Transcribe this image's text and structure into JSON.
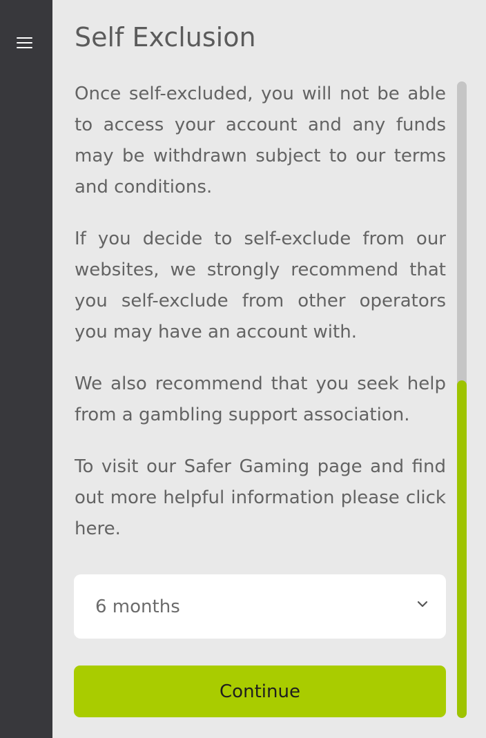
{
  "header": {
    "menu_icon": "hamburger-menu-icon",
    "title": "Self Exclusion"
  },
  "content": {
    "paragraphs": [
      "Once self-excluded, you will not be able to access your account and any funds may be withdrawn subject to our terms and conditions.",
      "If you decide to self-exclude from our websites, we strongly recommend that you self-exclude from other operators you may have an account with.",
      "We also recommend that you seek help from a gambling support association.",
      "To visit our Safer Gaming page and find out more helpful information please click here."
    ]
  },
  "form": {
    "duration_selected": "6 months",
    "dropdown_icon": "chevron-down-icon",
    "continue_label": "Continue"
  },
  "scrollbar": {
    "progress_fraction": 0.53
  },
  "colors": {
    "sidebar": "#38383c",
    "background": "#e9e9e9",
    "accent": "#a9cc00",
    "text": "#636363"
  }
}
